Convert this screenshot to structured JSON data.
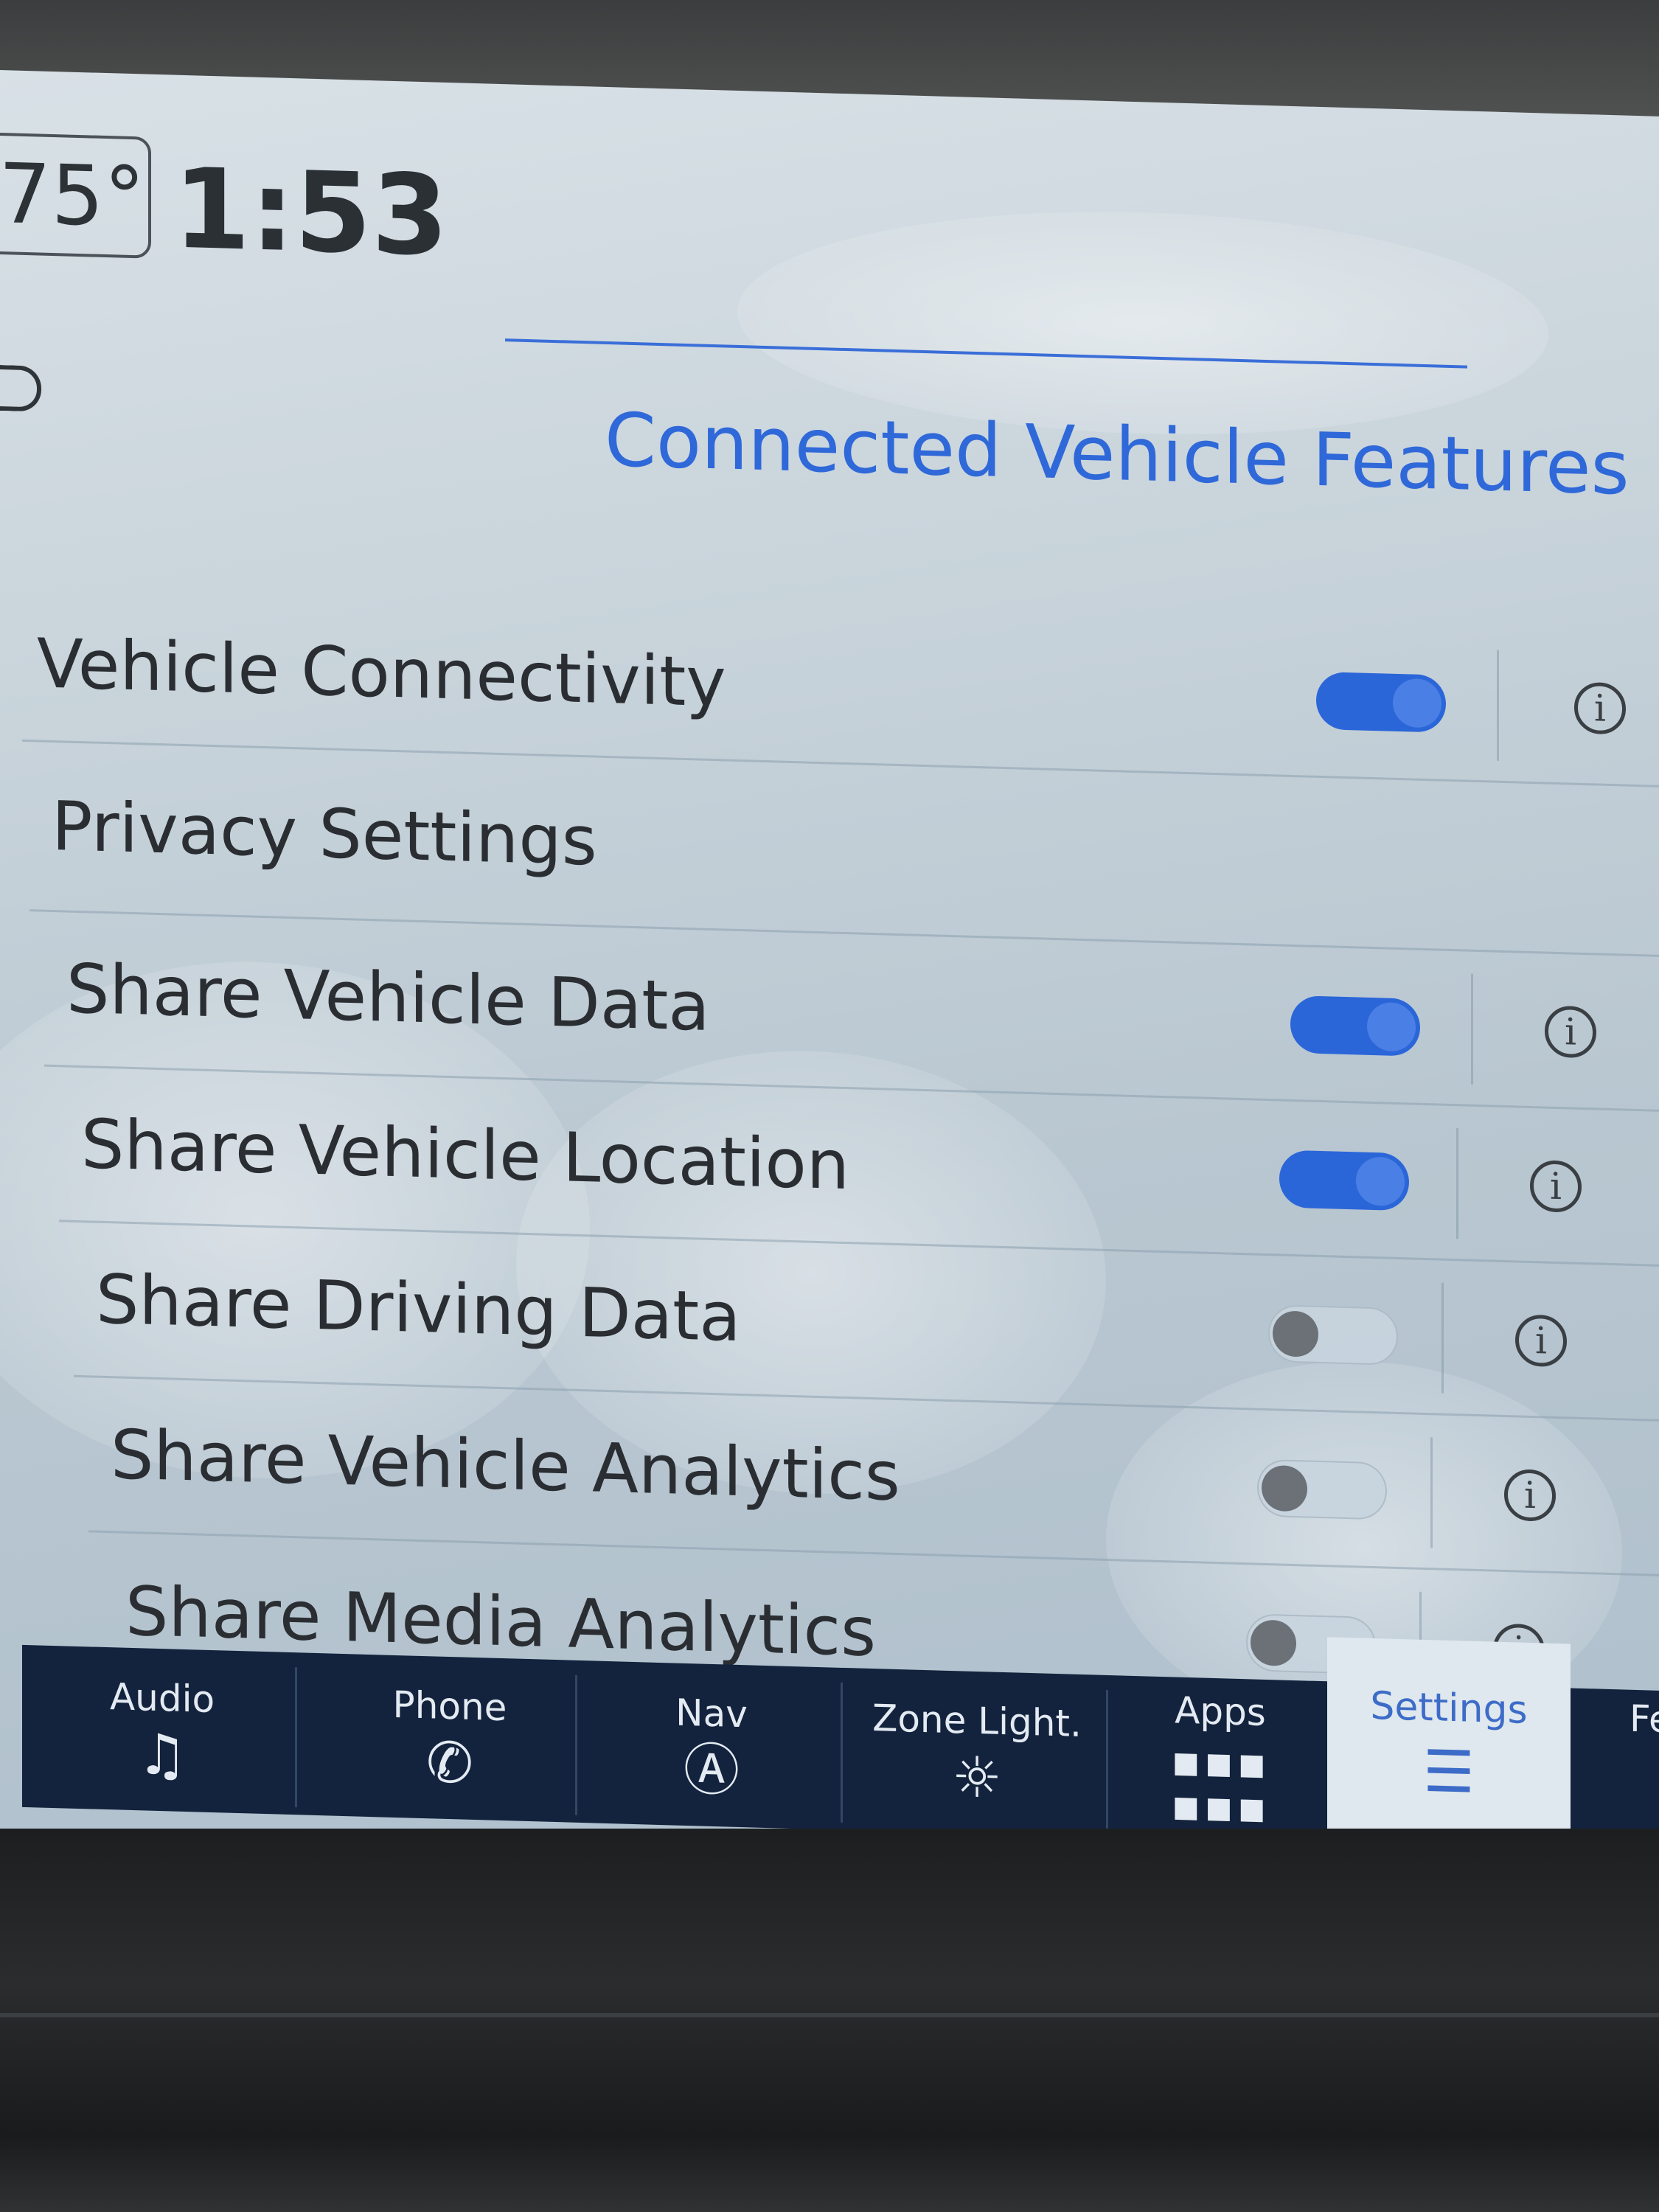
{
  "status_bar": {
    "temperature": "75°",
    "time": "1:53"
  },
  "page": {
    "title": "Connected Vehicle Features"
  },
  "settings": {
    "vehicle_connectivity": {
      "label": "Vehicle Connectivity",
      "enabled": true
    },
    "section_header": "Privacy Settings",
    "items": [
      {
        "label": "Share Vehicle Data",
        "enabled": true
      },
      {
        "label": "Share Vehicle Location",
        "enabled": true
      },
      {
        "label": "Share Driving Data",
        "enabled": false
      },
      {
        "label": "Share Vehicle Analytics",
        "enabled": false
      },
      {
        "label": "Share Media Analytics",
        "enabled": false
      }
    ]
  },
  "nav": {
    "audio": "Audio",
    "phone": "Phone",
    "nav": "Nav",
    "zone_light": "Zone Light.",
    "apps": "Apps",
    "settings": "Settings",
    "partial": "Fe"
  },
  "colors": {
    "accent": "#2b66d9",
    "navbar": "#13233d",
    "title": "#2f68d8"
  }
}
